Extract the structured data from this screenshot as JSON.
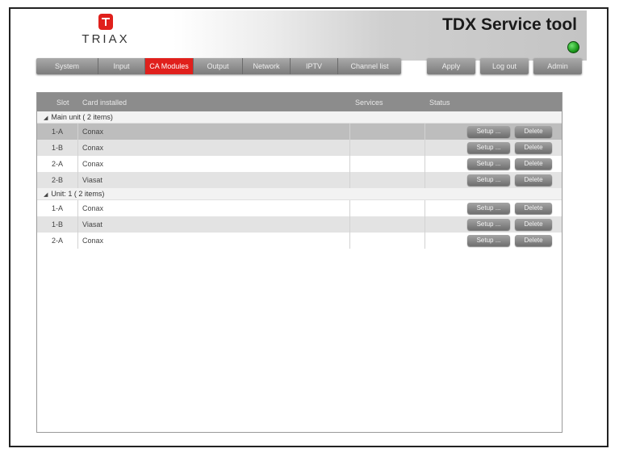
{
  "header": {
    "logo_text": "TRIAX",
    "app_title": "TDX Service tool"
  },
  "nav": {
    "tabs": [
      {
        "label": "System",
        "active": false
      },
      {
        "label": "Input",
        "active": false
      },
      {
        "label": "CA Modules",
        "active": true
      },
      {
        "label": "Output",
        "active": false
      },
      {
        "label": "Network",
        "active": false
      },
      {
        "label": "IPTV",
        "active": false
      },
      {
        "label": "Channel list",
        "active": false
      }
    ],
    "actions": [
      "Apply",
      "Log out",
      "Admin"
    ]
  },
  "table": {
    "columns": {
      "slot": "Slot",
      "card": "Card installed",
      "services": "Services",
      "status": "Status"
    },
    "row_buttons": {
      "setup": "Setup ...",
      "delete": "Delete"
    },
    "groups": [
      {
        "label": "Main unit ( 2 items)",
        "rows": [
          {
            "slot": "1-A",
            "card": "Conax"
          },
          {
            "slot": "1-B",
            "card": "Conax"
          },
          {
            "slot": "2-A",
            "card": "Conax"
          },
          {
            "slot": "2-B",
            "card": "Viasat"
          }
        ]
      },
      {
        "label": "Unit: 1 ( 2 items)",
        "rows": [
          {
            "slot": "1-A",
            "card": "Conax"
          },
          {
            "slot": "1-B",
            "card": "Viasat"
          },
          {
            "slot": "2-A",
            "card": "Conax"
          }
        ]
      }
    ]
  },
  "colors": {
    "accent": "#e0201c",
    "status_led": "#1c9a1c"
  }
}
